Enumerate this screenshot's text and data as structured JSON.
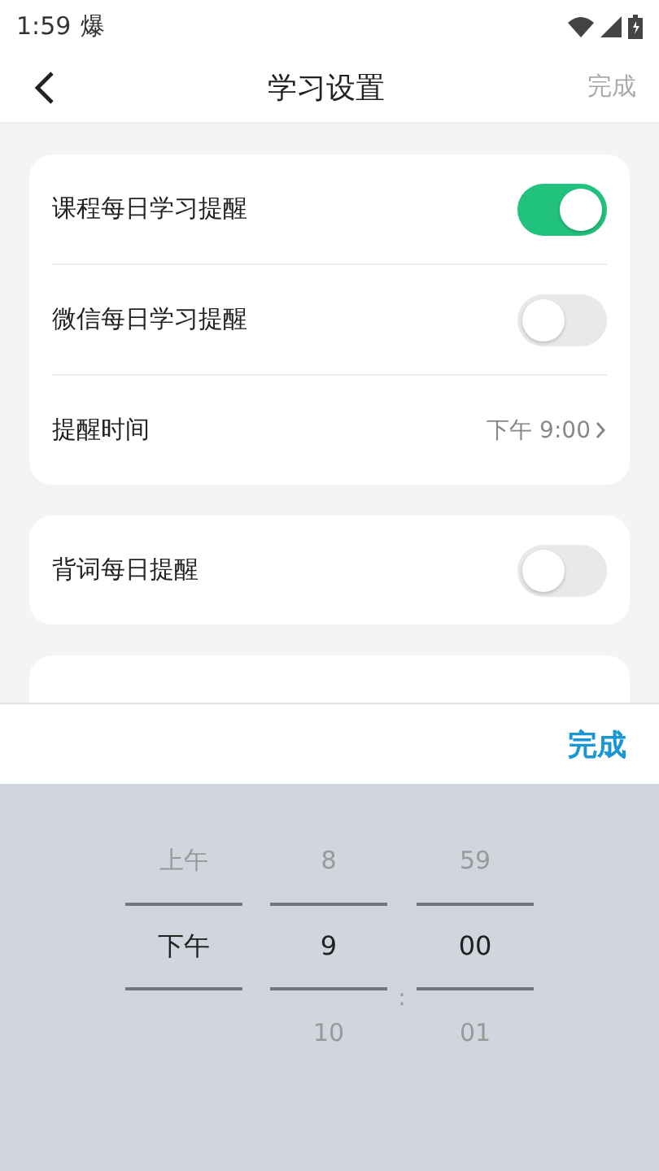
{
  "status_bar": {
    "time": "1:59",
    "notification": "爆"
  },
  "header": {
    "title": "学习设置",
    "action": "完成"
  },
  "sections": [
    {
      "items": [
        {
          "kind": "toggle",
          "label": "课程每日学习提醒",
          "on": true
        },
        {
          "kind": "toggle",
          "label": "微信每日学习提醒",
          "on": false
        },
        {
          "kind": "value",
          "label": "提醒时间",
          "value": "下午 9:00"
        }
      ]
    },
    {
      "items": [
        {
          "kind": "toggle",
          "label": "背词每日提醒",
          "on": false
        }
      ]
    }
  ],
  "picker": {
    "done": "完成",
    "separator": ":",
    "columns": [
      {
        "items": [
          {
            "text": "上午",
            "selected": false
          },
          {
            "text": "下午",
            "selected": true
          }
        ]
      },
      {
        "items": [
          {
            "text": "8",
            "selected": false
          },
          {
            "text": "9",
            "selected": true
          },
          {
            "text": "10",
            "selected": false
          }
        ]
      },
      {
        "items": [
          {
            "text": "59",
            "selected": false
          },
          {
            "text": "00",
            "selected": true
          },
          {
            "text": "01",
            "selected": false
          }
        ]
      }
    ]
  }
}
